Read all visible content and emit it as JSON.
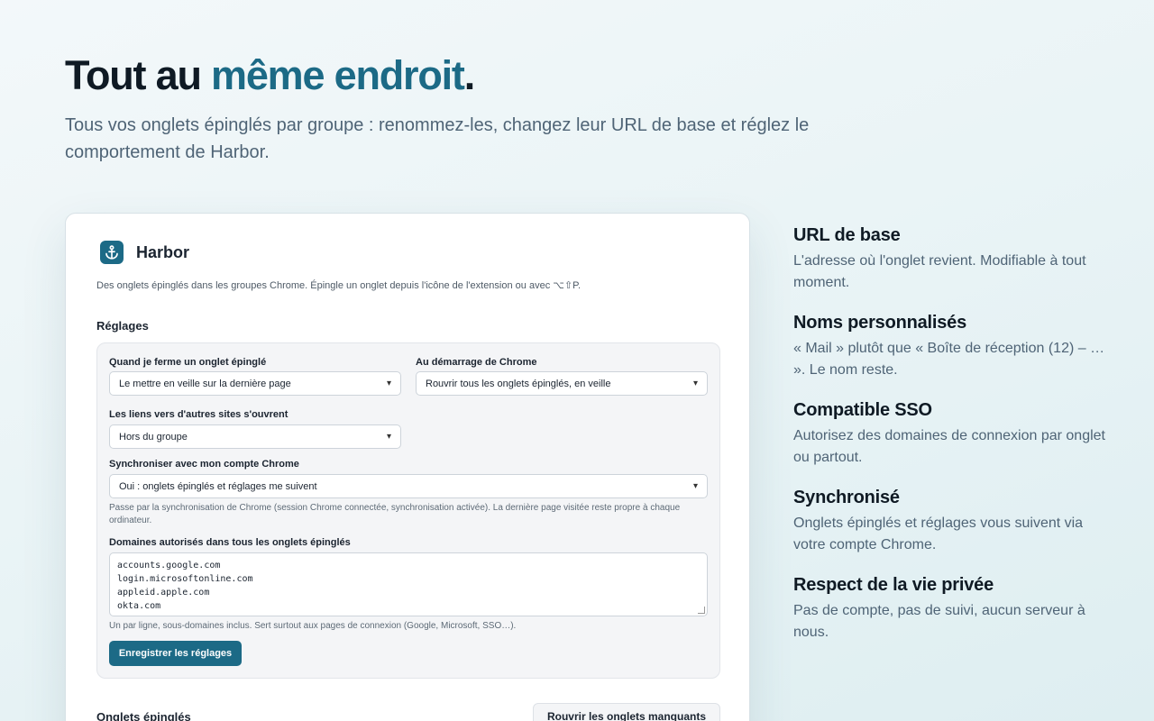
{
  "hero": {
    "title_plain": "Tout au ",
    "title_accent": "même endroit",
    "title_end": ".",
    "subtitle": "Tous vos onglets épinglés par groupe : renommez-les, changez leur URL de base et réglez le comportement de Harbor."
  },
  "app": {
    "name": "Harbor",
    "logo_icon": "anchor-icon",
    "description": "Des onglets épinglés dans les groupes Chrome. Épingle un onglet depuis l'icône de l'extension ou avec ⌥⇧P."
  },
  "settings": {
    "section_title": "Réglages",
    "close_behavior": {
      "label": "Quand je ferme un onglet épinglé",
      "value": "Le mettre en veille sur la dernière page"
    },
    "startup": {
      "label": "Au démarrage de Chrome",
      "value": "Rouvrir tous les onglets épinglés, en veille"
    },
    "links": {
      "label": "Les liens vers d'autres sites s'ouvrent",
      "value": "Hors du groupe"
    },
    "sync": {
      "label": "Synchroniser avec mon compte Chrome",
      "value": "Oui : onglets épinglés et réglages me suivent",
      "hint": "Passe par la synchronisation de Chrome (session Chrome connectée, synchronisation activée). La dernière page visitée reste propre à chaque ordinateur."
    },
    "domains": {
      "label": "Domaines autorisés dans tous les onglets épinglés",
      "lines": [
        "accounts.google.com",
        "login.microsoftonline.com",
        "appleid.apple.com",
        "okta.com"
      ],
      "hint": "Un par ligne, sous-domaines inclus. Sert surtout aux pages de connexion (Google, Microsoft, SSO…)."
    },
    "save_label": "Enregistrer les réglages"
  },
  "pinned": {
    "section_title": "Onglets épinglés",
    "reopen_label": "Rouvrir les onglets manquants"
  },
  "features": [
    {
      "title": "URL de base",
      "text": "L'adresse où l'onglet revient. Modifiable à tout moment."
    },
    {
      "title": "Noms personnalisés",
      "text": "« Mail » plutôt que « Boîte de réception (12) – … ». Le nom reste."
    },
    {
      "title": "Compatible SSO",
      "text": "Autorisez des domaines de connexion par onglet ou partout."
    },
    {
      "title": "Synchronisé",
      "text": "Onglets épinglés et réglages vous suivent via votre compte Chrome."
    },
    {
      "title": "Respect de la vie privée",
      "text": "Pas de compte, pas de suivi, aucun serveur à nous."
    }
  ],
  "colors": {
    "accent": "#1c6a86",
    "text": "#0f1a24",
    "muted": "#4f6476"
  }
}
